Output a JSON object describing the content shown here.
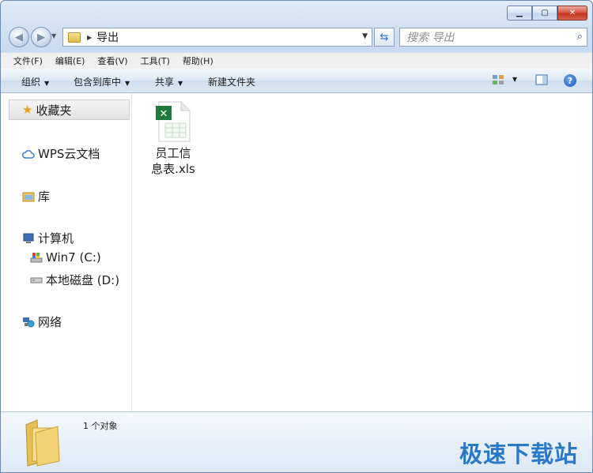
{
  "window": {
    "minimize_icon": "minimize-icon",
    "restore_icon": "restore-icon",
    "close_icon": "close-icon"
  },
  "address": {
    "path": "导出"
  },
  "search": {
    "placeholder": "搜索 导出"
  },
  "menu": [
    "文件(F)",
    "编辑(E)",
    "查看(V)",
    "工具(T)",
    "帮助(H)"
  ],
  "toolbar": {
    "organize": "组织",
    "include_library": "包含到库中",
    "share": "共享",
    "new_folder": "新建文件夹"
  },
  "sidebar": {
    "favorites": "收藏夹",
    "wps": "WPS云文档",
    "library": "库",
    "computer": "计算机",
    "drive_c": "Win7 (C:)",
    "drive_d": "本地磁盘 (D:)",
    "network": "网络"
  },
  "files": [
    {
      "name_line1": "员工信",
      "name_line2": "息表.xls",
      "icon": "excel-file-icon"
    }
  ],
  "status": {
    "count": "1 个对象"
  },
  "watermark": "极速下载站",
  "colors": {
    "accent": "#2a78c8",
    "excel_green": "#1f7a3a"
  }
}
